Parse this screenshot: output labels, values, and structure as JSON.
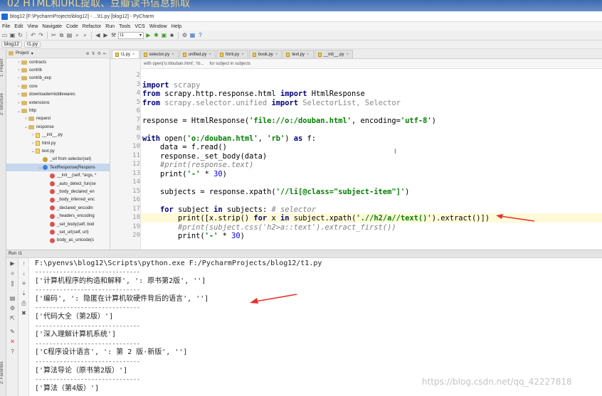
{
  "overlay_caption": "02 HTML和URL提取、豆瓣读书信息抓取",
  "window": {
    "title": "blog12 [F:\\PycharmProjects\\blog12] - ...\\t1.py [blog12] - PyCharm"
  },
  "menu": [
    "File",
    "Edit",
    "View",
    "Navigate",
    "Code",
    "Refactor",
    "Run",
    "Tools",
    "VCS",
    "Window",
    "Help"
  ],
  "toolbar": {
    "run_config": "t1"
  },
  "nav": {
    "project": "blog12",
    "file": "t1.py"
  },
  "project_panel": {
    "header": "Project",
    "items": [
      {
        "label": "contracts",
        "kind": "folder",
        "depth": 1,
        "arrow": ">"
      },
      {
        "label": "contrib",
        "kind": "folder",
        "depth": 1,
        "arrow": ">"
      },
      {
        "label": "contrib_exp",
        "kind": "folder",
        "depth": 1,
        "arrow": ">"
      },
      {
        "label": "core",
        "kind": "folder",
        "depth": 1,
        "arrow": ">"
      },
      {
        "label": "downloadermiddlewares",
        "kind": "folder",
        "depth": 1,
        "arrow": ">"
      },
      {
        "label": "extensions",
        "kind": "folder",
        "depth": 1,
        "arrow": ">"
      },
      {
        "label": "http",
        "kind": "folder",
        "depth": 1,
        "arrow": "v"
      },
      {
        "label": "request",
        "kind": "folder",
        "depth": 2,
        "arrow": ">"
      },
      {
        "label": "response",
        "kind": "folder",
        "depth": 2,
        "arrow": "v"
      },
      {
        "label": "__init__.py",
        "kind": "file",
        "depth": 3,
        "arrow": ">"
      },
      {
        "label": "html.py",
        "kind": "file",
        "depth": 3,
        "arrow": ">"
      },
      {
        "label": "text.py",
        "kind": "file",
        "depth": 3,
        "arrow": "v"
      },
      {
        "label": "_url from selector(sel)",
        "kind": "fx",
        "depth": 4,
        "arrow": ""
      },
      {
        "label": "TextResponse(Respons",
        "kind": "cls",
        "depth": 4,
        "arrow": "v",
        "selected": true
      },
      {
        "label": "__init__(self, *args, *",
        "kind": "m",
        "depth": 5,
        "arrow": ""
      },
      {
        "label": "_auto_detect_fun(se",
        "kind": "m",
        "depth": 5,
        "arrow": ""
      },
      {
        "label": "_body_declared_en",
        "kind": "m",
        "depth": 5,
        "arrow": ""
      },
      {
        "label": "_body_inferred_enc",
        "kind": "m",
        "depth": 5,
        "arrow": ""
      },
      {
        "label": "_declared_encodin",
        "kind": "m",
        "depth": 5,
        "arrow": ""
      },
      {
        "label": "_headers_encoding",
        "kind": "m",
        "depth": 5,
        "arrow": ""
      },
      {
        "label": "_set_body(self, bod",
        "kind": "m",
        "depth": 5,
        "arrow": ""
      },
      {
        "label": "_set_url(self, url)",
        "kind": "m",
        "depth": 5,
        "arrow": ""
      },
      {
        "label": "body_as_unicode(s",
        "kind": "m",
        "depth": 5,
        "arrow": ""
      }
    ]
  },
  "editor_tabs": [
    {
      "label": "t1.py",
      "active": true
    },
    {
      "label": "selector.py",
      "active": false
    },
    {
      "label": "unified.py",
      "active": false
    },
    {
      "label": "html.py",
      "active": false
    },
    {
      "label": "book.py",
      "active": false
    },
    {
      "label": "text.py",
      "active": false
    },
    {
      "label": "__init__.py",
      "active": false
    }
  ],
  "editor_breadcrumb": [
    "with open('o:/douban.html', 'rb...",
    "for subject in subjects"
  ],
  "line_numbers": [
    "2",
    "3",
    "4",
    "5",
    "6",
    "7",
    "8",
    "9",
    "10",
    "11",
    "12",
    "13",
    "14",
    "15",
    "16",
    "17",
    "18",
    "19",
    "20"
  ],
  "code_lines": [
    [],
    [
      {
        "t": "import",
        "c": "kw"
      },
      {
        "t": " scrapy",
        "c": "dim"
      }
    ],
    [
      {
        "t": "from",
        "c": "kw"
      },
      {
        "t": " scrapy.http.response.html ",
        "c": ""
      },
      {
        "t": "import",
        "c": "kw"
      },
      {
        "t": " HtmlResponse",
        "c": ""
      }
    ],
    [
      {
        "t": "from",
        "c": "kw"
      },
      {
        "t": " scrapy.selector.unified ",
        "c": "dim"
      },
      {
        "t": "import",
        "c": "kw"
      },
      {
        "t": " SelectorList, Selector",
        "c": "dim"
      }
    ],
    [],
    [
      {
        "t": "response = HtmlResponse(",
        "c": ""
      },
      {
        "t": "'file://o:/douban.html'",
        "c": "str"
      },
      {
        "t": ", encoding=",
        "c": ""
      },
      {
        "t": "'utf-8'",
        "c": "str"
      },
      {
        "t": ")",
        "c": ""
      }
    ],
    [],
    [
      {
        "t": "with",
        "c": "kw"
      },
      {
        "t": " open(",
        "c": ""
      },
      {
        "t": "'o:/douban.html'",
        "c": "str"
      },
      {
        "t": ", ",
        "c": ""
      },
      {
        "t": "'rb'",
        "c": "str"
      },
      {
        "t": ") ",
        "c": ""
      },
      {
        "t": "as",
        "c": "kw"
      },
      {
        "t": " f:",
        "c": ""
      }
    ],
    [
      {
        "t": "    data = f.read()",
        "c": ""
      }
    ],
    [
      {
        "t": "    response._set_body(data)",
        "c": ""
      }
    ],
    [
      {
        "t": "    #print(response.text)",
        "c": "cm"
      }
    ],
    [
      {
        "t": "    print(",
        "c": ""
      },
      {
        "t": "'-'",
        "c": "str"
      },
      {
        "t": " * ",
        "c": ""
      },
      {
        "t": "30",
        "c": "num"
      },
      {
        "t": ")",
        "c": ""
      }
    ],
    [],
    [
      {
        "t": "    subjects = response.xpath(",
        "c": ""
      },
      {
        "t": "'//li[@class=\"subject-item\"]'",
        "c": "str"
      },
      {
        "t": ")",
        "c": ""
      }
    ],
    [],
    [
      {
        "t": "    ",
        "c": ""
      },
      {
        "t": "for",
        "c": "kw"
      },
      {
        "t": " subject ",
        "c": ""
      },
      {
        "t": "in",
        "c": "kw"
      },
      {
        "t": " subjects: ",
        "c": ""
      },
      {
        "t": "# selector",
        "c": "cm"
      }
    ],
    [
      {
        "t": "        print([x.strip() ",
        "c": ""
      },
      {
        "t": "for",
        "c": "kw"
      },
      {
        "t": " x ",
        "c": ""
      },
      {
        "t": "in",
        "c": "kw"
      },
      {
        "t": " subject.xpath(",
        "c": ""
      },
      {
        "t": "'.//h2/a//text()'",
        "c": "str"
      },
      {
        "t": ").extract()])",
        "c": ""
      }
    ],
    [
      {
        "t": "        #print(subject.css('h2>a::text').extract_first())",
        "c": "cm"
      }
    ],
    [
      {
        "t": "        print(",
        "c": ""
      },
      {
        "t": "'-'",
        "c": "str"
      },
      {
        "t": " * ",
        "c": ""
      },
      {
        "t": "30",
        "c": "num"
      },
      {
        "t": ")",
        "c": ""
      }
    ]
  ],
  "run_panel": {
    "title": "Run",
    "config": "t1",
    "command": "F:\\pyenvs\\blog12\\Scripts\\python.exe F:/PycharmProjects/blog12/t1.py",
    "output": [
      "------------------------------",
      "['计算机程序的构造和解释', ': 原书第2版', '']",
      "------------------------------",
      "['编码', ': 隐匿在计算机软硬件背后的语言', '']",
      "------------------------------",
      "['代码大全（第2版）']",
      "------------------------------",
      "['深入理解计算机系统']",
      "------------------------------",
      "['C程序设计语言', ': 第 2 版·新版', '']",
      "------------------------------",
      "['算法导论（原书第2版）']",
      "------------------------------",
      "['算法（第4版）']"
    ]
  },
  "watermark": "https://blog.csdn.net/qq_42227818",
  "left_tabs": [
    "1: Project",
    "2: Structure",
    "2: Favorites"
  ],
  "colors": {
    "arrow": "#e8302a",
    "selection": "#c6d7ee",
    "current_line": "#fffbd8"
  }
}
